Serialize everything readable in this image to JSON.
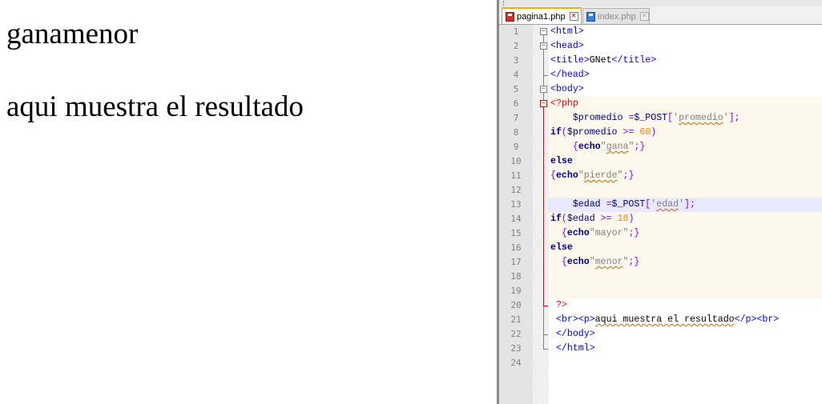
{
  "browser": {
    "output_line_1": "ganamenor",
    "output_line_2": "aqui muestra el resultado"
  },
  "editor": {
    "tabs": [
      {
        "label": "pagina1.php",
        "icon": "file-modified-red-icon",
        "active": true
      },
      {
        "label": "index.php",
        "icon": "file-saved-blue-icon",
        "active": false
      }
    ],
    "line_numbers": [
      "1",
      "2",
      "3",
      "4",
      "5",
      "6",
      "7",
      "8",
      "9",
      "10",
      "11",
      "12",
      "13",
      "14",
      "15",
      "16",
      "17",
      "18",
      "19",
      "20",
      "21",
      "22",
      "23",
      "24"
    ],
    "current_line": 13,
    "colors": {
      "tag": "#0000ff",
      "keyword": "#000080",
      "string": "#808080",
      "number": "#ff8000",
      "operator": "#8000ff",
      "php_delimiter": "#ff0000",
      "php_block_background": "#fdf8ec",
      "current_line_background": "#e8e8ff",
      "active_tab_accent": "#f5a623"
    },
    "lines": [
      [
        {
          "t": "<html>",
          "c": "tag"
        }
      ],
      [
        {
          "t": "<head>",
          "c": "tag"
        }
      ],
      [
        {
          "t": "<title>",
          "c": "tag"
        },
        {
          "t": "GNet",
          "c": "plain"
        },
        {
          "t": "</title>",
          "c": "tag"
        }
      ],
      [
        {
          "t": "</head>",
          "c": "tag"
        }
      ],
      [
        {
          "t": "<body>",
          "c": "tag"
        }
      ],
      [
        {
          "t": "<?php",
          "c": "php"
        }
      ],
      [
        {
          "t": "    $promedio ",
          "c": "var"
        },
        {
          "t": "=",
          "c": "op"
        },
        {
          "t": "$_POST",
          "c": "var"
        },
        {
          "t": "[",
          "c": "op"
        },
        {
          "t": "'",
          "c": "str"
        },
        {
          "t": "promedio",
          "c": "str squig"
        },
        {
          "t": "'",
          "c": "str"
        },
        {
          "t": "];",
          "c": "op"
        }
      ],
      [
        {
          "t": "if",
          "c": "kw"
        },
        {
          "t": "(",
          "c": "op"
        },
        {
          "t": "$promedio ",
          "c": "var"
        },
        {
          "t": ">=",
          "c": "op"
        },
        {
          "t": " ",
          "c": "plain"
        },
        {
          "t": "60",
          "c": "num"
        },
        {
          "t": ")",
          "c": "op"
        }
      ],
      [
        {
          "t": "    ",
          "c": "plain"
        },
        {
          "t": "{",
          "c": "op"
        },
        {
          "t": "echo",
          "c": "kw"
        },
        {
          "t": "\"",
          "c": "str"
        },
        {
          "t": "gana",
          "c": "str squig"
        },
        {
          "t": "\"",
          "c": "str"
        },
        {
          "t": ";}",
          "c": "op"
        }
      ],
      [
        {
          "t": "else",
          "c": "kw"
        }
      ],
      [
        {
          "t": "{",
          "c": "op"
        },
        {
          "t": "echo",
          "c": "kw"
        },
        {
          "t": "\"",
          "c": "str"
        },
        {
          "t": "pierde",
          "c": "str squig"
        },
        {
          "t": "\"",
          "c": "str"
        },
        {
          "t": ";}",
          "c": "op"
        }
      ],
      [],
      [
        {
          "t": "    $edad ",
          "c": "var"
        },
        {
          "t": "=",
          "c": "op"
        },
        {
          "t": "$_POST",
          "c": "var"
        },
        {
          "t": "[",
          "c": "op"
        },
        {
          "t": "'",
          "c": "str"
        },
        {
          "t": "edad",
          "c": "str squig"
        },
        {
          "t": "'",
          "c": "str"
        },
        {
          "t": "];",
          "c": "op"
        }
      ],
      [
        {
          "t": "if",
          "c": "kw"
        },
        {
          "t": "(",
          "c": "op"
        },
        {
          "t": "$edad ",
          "c": "var"
        },
        {
          "t": ">=",
          "c": "op"
        },
        {
          "t": " ",
          "c": "plain"
        },
        {
          "t": "18",
          "c": "num"
        },
        {
          "t": ")",
          "c": "op"
        }
      ],
      [
        {
          "t": "  ",
          "c": "plain"
        },
        {
          "t": "{",
          "c": "op"
        },
        {
          "t": "echo",
          "c": "kw"
        },
        {
          "t": "\"mayor\"",
          "c": "str"
        },
        {
          "t": ";}",
          "c": "op"
        }
      ],
      [
        {
          "t": "else",
          "c": "kw"
        }
      ],
      [
        {
          "t": "  ",
          "c": "plain"
        },
        {
          "t": "{",
          "c": "op"
        },
        {
          "t": "echo",
          "c": "kw"
        },
        {
          "t": "\"",
          "c": "str"
        },
        {
          "t": "menor",
          "c": "str squig"
        },
        {
          "t": "\"",
          "c": "str"
        },
        {
          "t": ";}",
          "c": "op"
        }
      ],
      [],
      [],
      [
        {
          "t": " ?>",
          "c": "php"
        }
      ],
      [
        {
          "t": " <br><p>",
          "c": "tag"
        },
        {
          "t": "aqui muestra el resultado",
          "c": "plain squig"
        },
        {
          "t": "</p><br>",
          "c": "tag"
        }
      ],
      [
        {
          "t": " </body>",
          "c": "tag"
        }
      ],
      [
        {
          "t": " </html>",
          "c": "tag"
        }
      ],
      []
    ]
  }
}
